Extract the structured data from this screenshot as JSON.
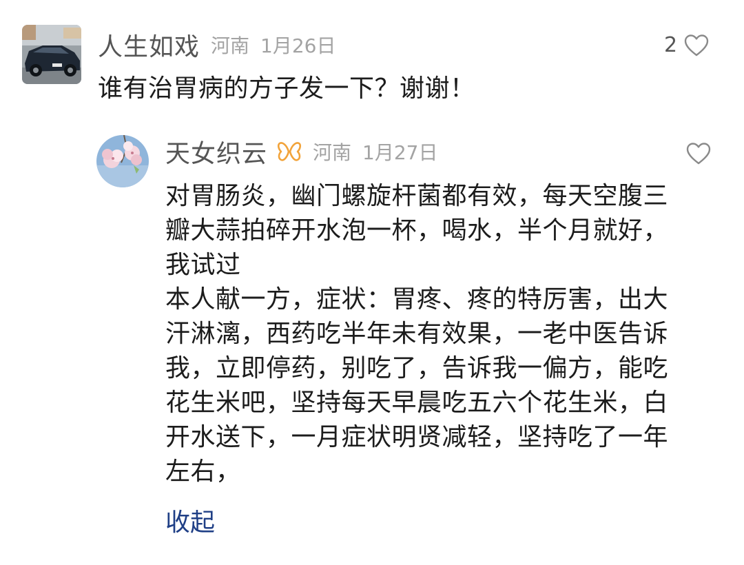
{
  "top_comment": {
    "username": "人生如戏",
    "location": "河南",
    "date": "1月26日",
    "like_count": "2",
    "text": "谁有治胃病的方子发一下？谢谢！",
    "avatar_icon": "car-photo-avatar"
  },
  "reply": {
    "username": "天女织云",
    "badge_icon": "butterfly-badge-icon",
    "location": "河南",
    "date": "1月27日",
    "text_lines": [
      "对胃肠炎，幽门螺旋杆菌都有效，每天空腹三",
      "瓣大蒜拍碎开水泡一杯，喝水，半个月就好，",
      "我试过",
      "本人献一方，症状：胃疼、疼的特厉害，出大",
      "汗淋漓，西药吃半年未有效果，一老中医告诉",
      "我，立即停药，别吃了，告诉我一偏方，能吃",
      "花生米吧，坚持每天早晨吃五六个花生米，白",
      "开水送下，一月症状明贤减轻，坚持吃了一年",
      "左右，"
    ],
    "collapse_label": "收起",
    "avatar_icon": "cherry-blossom-avatar"
  },
  "colors": {
    "username": "#555555",
    "meta": "#a3a3a3",
    "text": "#1c1c1c",
    "link": "#1f3f86",
    "badge": "#f2a33a"
  }
}
